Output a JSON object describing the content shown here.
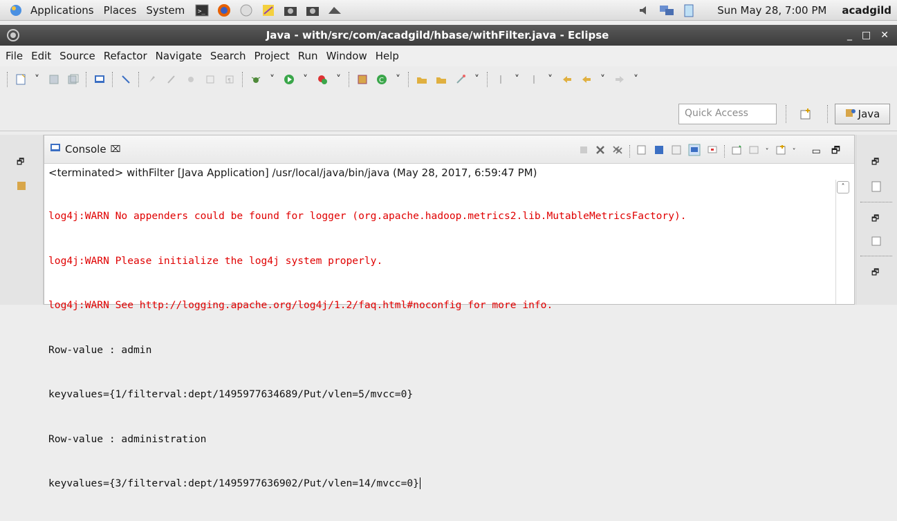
{
  "topbar": {
    "menus": [
      "Applications",
      "Places",
      "System"
    ],
    "clock": "Sun May 28,  7:00 PM",
    "user": "acadgild"
  },
  "window": {
    "title": "Java - with/src/com/acadgild/hbase/withFilter.java - Eclipse"
  },
  "menubar": {
    "items": [
      "File",
      "Edit",
      "Source",
      "Refactor",
      "Navigate",
      "Search",
      "Project",
      "Run",
      "Window",
      "Help"
    ]
  },
  "quick_access": {
    "placeholder": "Quick Access"
  },
  "perspective": {
    "label": "Java"
  },
  "console": {
    "tab_label": "Console",
    "status": "<terminated> withFilter [Java Application] /usr/local/java/bin/java (May 28, 2017, 6:59:47 PM)",
    "lines": [
      {
        "text": "log4j:WARN No appenders could be found for logger (org.apache.hadoop.metrics2.lib.MutableMetricsFactory).",
        "color": "#e00000"
      },
      {
        "text": "log4j:WARN Please initialize the log4j system properly.",
        "color": "#e00000"
      },
      {
        "text": "log4j:WARN See http://logging.apache.org/log4j/1.2/faq.html#noconfig for more info.",
        "color": "#e00000"
      },
      {
        "text": "Row-value : admin",
        "color": "#111111"
      },
      {
        "text": "keyvalues={1/filterval:dept/1495977634689/Put/vlen=5/mvcc=0}",
        "color": "#111111"
      },
      {
        "text": "Row-value : administration",
        "color": "#111111"
      },
      {
        "text": "keyvalues={3/filterval:dept/1495977636902/Put/vlen=14/mvcc=0}",
        "color": "#111111"
      }
    ]
  }
}
